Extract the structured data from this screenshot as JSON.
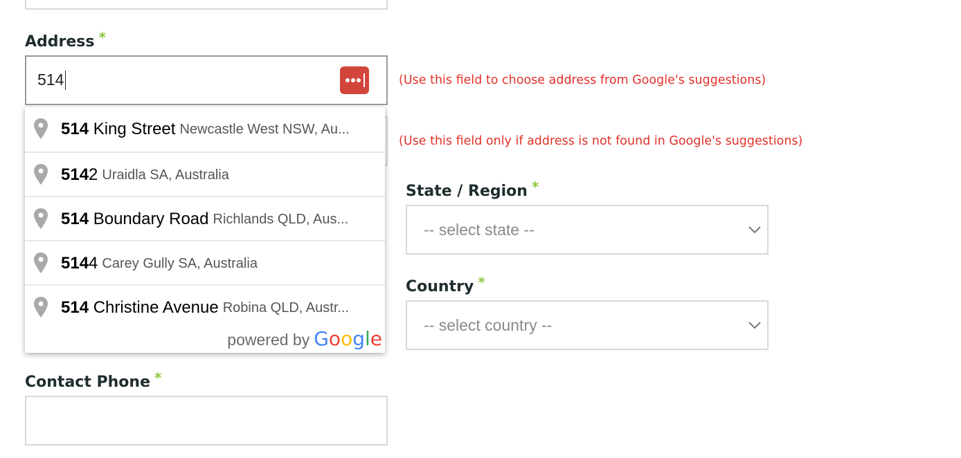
{
  "form": {
    "address": {
      "label": "Address",
      "required_mark": "*",
      "value": "514",
      "hint": "(Use this field to choose address from Google's suggestions)"
    },
    "manual_address": {
      "hint": "(Use this field only if address is not found in Google's suggestions)"
    },
    "state": {
      "label": "State / Region",
      "required_mark": "*",
      "selected": "-- select state --"
    },
    "country": {
      "label": "Country",
      "required_mark": "*",
      "selected": "-- select country --"
    },
    "contact_phone": {
      "label": "Contact Phone",
      "required_mark": "*",
      "value": ""
    }
  },
  "autocomplete": {
    "suggestions": [
      {
        "match": "514",
        "rest": " King Street",
        "secondary": "Newcastle West NSW, Au..."
      },
      {
        "match": "514",
        "rest": "2",
        "secondary": "Uraidla SA, Australia"
      },
      {
        "match": "514",
        "rest": " Boundary Road",
        "secondary": "Richlands QLD, Aus..."
      },
      {
        "match": "514",
        "rest": "4",
        "secondary": "Carey Gully SA, Australia"
      },
      {
        "match": "514",
        "rest": " Christine Avenue",
        "secondary": "Robina QLD, Austr..."
      }
    ],
    "powered_by": "powered by",
    "google_letters": [
      "G",
      "o",
      "o",
      "g",
      "l",
      "e"
    ]
  },
  "colors": {
    "required": "#8cc63f",
    "hint": "#e0322a",
    "password_manager_button": "#d2453a",
    "google": [
      "#4285F4",
      "#EA4335",
      "#FBBC05",
      "#4285F4",
      "#34A853",
      "#EA4335"
    ]
  },
  "icons": {
    "password_manager": "dots-icon",
    "pin": "map-pin-icon",
    "select": "chevron-down-icon"
  }
}
